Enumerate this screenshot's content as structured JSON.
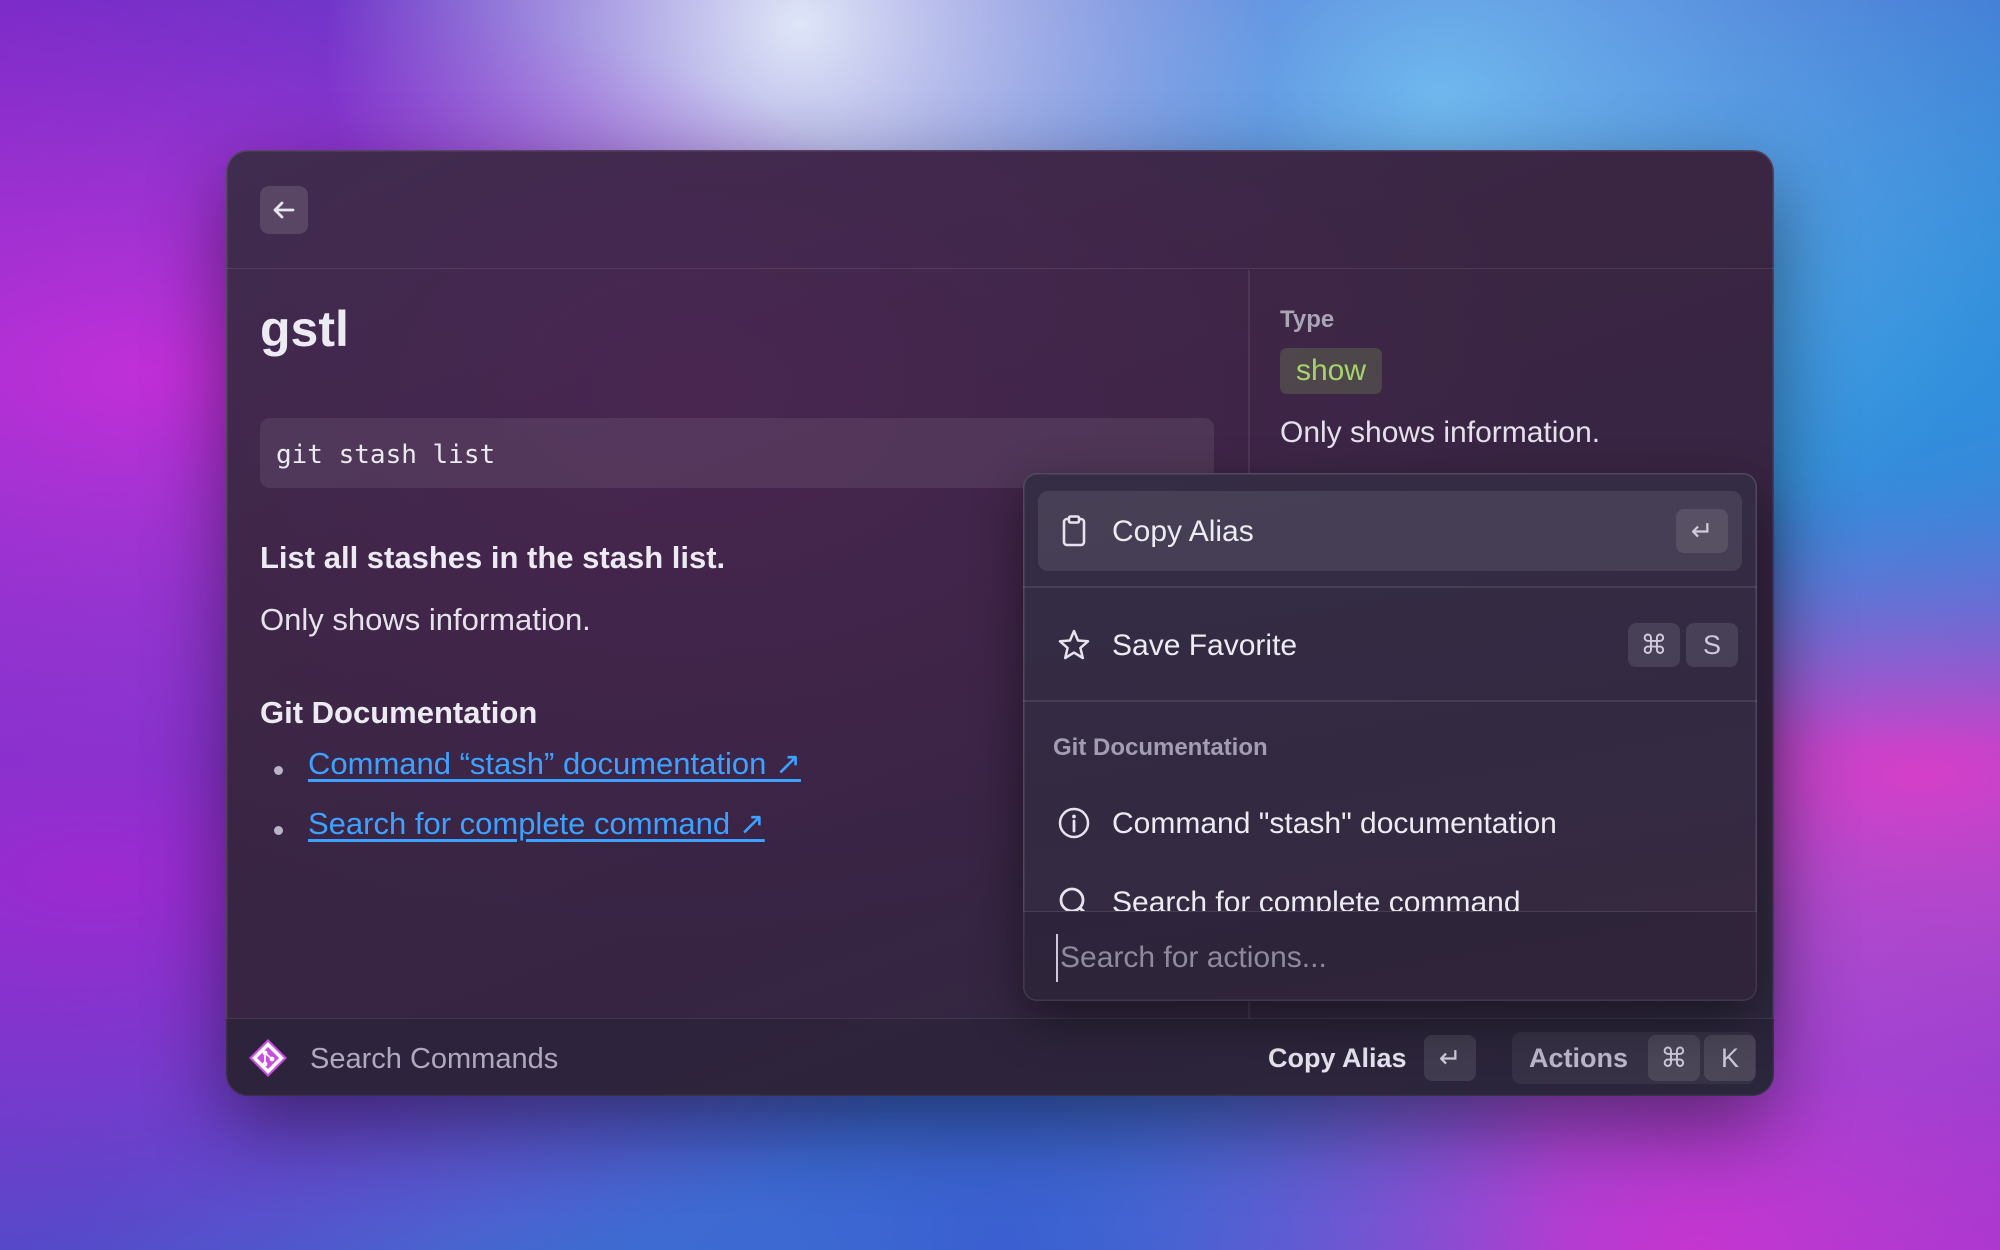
{
  "window": {
    "back_icon": "arrow-left-icon"
  },
  "detail": {
    "title": "gstl",
    "command": "git stash list",
    "summary": "List all stashes in the stash list.",
    "info": "Only shows information.",
    "docs_heading": "Git Documentation",
    "links": [
      {
        "label": "Command “stash” documentation ↗"
      },
      {
        "label": "Search for complete command ↗"
      }
    ]
  },
  "metadata": {
    "type_label": "Type",
    "type_tag": "show",
    "type_description": "Only shows information.",
    "tag_color": "#a6d46c"
  },
  "actions_panel": {
    "items": [
      {
        "label": "Copy Alias",
        "icon": "clipboard-icon",
        "shortcut": [
          "↵"
        ],
        "selected": true
      },
      {
        "label": "Save Favorite",
        "icon": "star-icon",
        "shortcut": [
          "⌘",
          "S"
        ]
      }
    ],
    "section_label": "Git Documentation",
    "section_items": [
      {
        "label": "Command \"stash\" documentation",
        "icon": "info-icon"
      },
      {
        "label": "Search for complete command",
        "icon": "search-icon"
      }
    ],
    "search_placeholder": "Search for actions..."
  },
  "footer": {
    "app_icon": "git-logo-icon",
    "search_label": "Search Commands",
    "primary_action": "Copy Alias",
    "primary_key": "↵",
    "actions_label": "Actions",
    "actions_keys": [
      "⌘",
      "K"
    ],
    "accent": "#c84de0"
  },
  "colors": {
    "link": "#3da2ff",
    "window_bg": "#372443"
  }
}
